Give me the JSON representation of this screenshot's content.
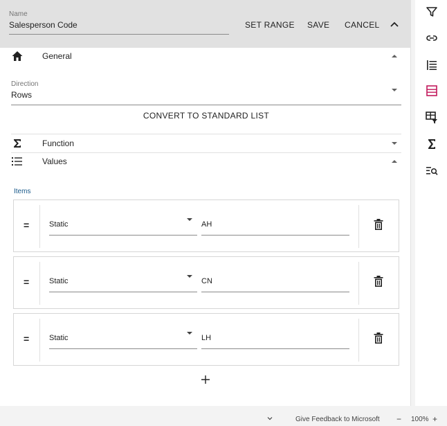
{
  "header": {
    "name_label": "Name",
    "name_value": "Salesperson Code",
    "set_range_label": "SET RANGE",
    "save_label": "SAVE",
    "cancel_label": "CANCEL"
  },
  "sections": {
    "general": "General",
    "function": "Function",
    "values": "Values"
  },
  "direction": {
    "label": "Direction",
    "value": "Rows"
  },
  "convert_label": "CONVERT TO STANDARD LIST",
  "items": {
    "label": "Items",
    "rows": [
      {
        "operator": "=",
        "type": "Static",
        "value": "AH"
      },
      {
        "operator": "=",
        "type": "Static",
        "value": "CN"
      },
      {
        "operator": "=",
        "type": "Static",
        "value": "LH"
      }
    ]
  },
  "rail_icons": [
    "filter-icon",
    "link-icon",
    "list-indent-icon",
    "table-rows-icon",
    "table-filter-icon",
    "sigma-icon",
    "list-search-icon"
  ],
  "colors": {
    "accent_active": "#c2185b",
    "header_bg": "#e1e1e1",
    "items_label": "#1a5a8a"
  },
  "statusbar": {
    "feedback": "Give Feedback to Microsoft",
    "zoom": "100%",
    "minus": "−",
    "plus": "+"
  }
}
